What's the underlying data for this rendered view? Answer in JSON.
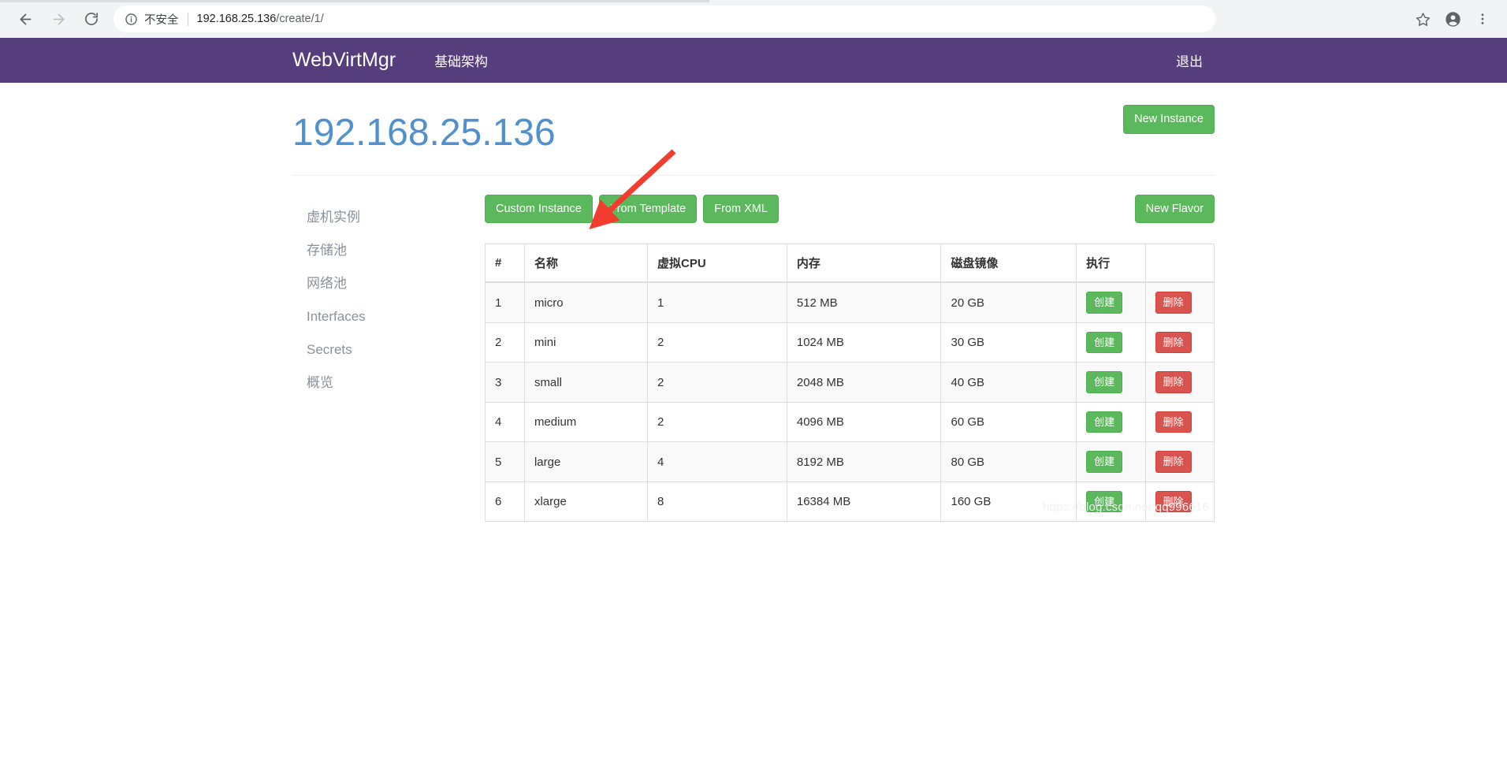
{
  "browser": {
    "back_icon": "arrow-left-icon",
    "forward_icon": "arrow-right-icon",
    "reload_icon": "reload-icon",
    "info_icon": "info-circle-icon",
    "security_label": "不安全",
    "url_host": "192.168.25.136",
    "url_path": "/create/1/",
    "bookmark_icon": "star-icon",
    "profile_icon": "account-avatar-icon",
    "menu_icon": "three-dot-menu-icon"
  },
  "navbar": {
    "brand": "WebVirtMgr",
    "links": [
      {
        "label": "基础架构"
      }
    ],
    "logout_label": "退出",
    "background_color": "#563d7c"
  },
  "page": {
    "title": "192.168.25.136",
    "title_color": "#4f90cd",
    "new_instance_label": "New Instance"
  },
  "sidebar": {
    "items": [
      {
        "label": "虚机实例"
      },
      {
        "label": "存储池"
      },
      {
        "label": "网络池"
      },
      {
        "label": "Interfaces"
      },
      {
        "label": "Secrets"
      },
      {
        "label": "概览"
      }
    ]
  },
  "toolbar": {
    "buttons": [
      {
        "label": "Custom Instance"
      },
      {
        "label": "From Template"
      },
      {
        "label": "From XML"
      }
    ],
    "new_flavor_label": "New Flavor"
  },
  "colors": {
    "success": "#5cb85c",
    "danger": "#d9534f",
    "accent_purple": "#563d7c",
    "heading_blue": "#4f90cd",
    "annotation_red": "#f23c2e"
  },
  "table": {
    "headers": [
      "#",
      "名称",
      "虚拟CPU",
      "内存",
      "磁盘镜像",
      "执行"
    ],
    "action_create_label": "创建",
    "action_delete_label": "删除",
    "rows": [
      {
        "idx": "1",
        "name": "micro",
        "vcpu": "1",
        "memory": "512 MB",
        "disk": "20 GB"
      },
      {
        "idx": "2",
        "name": "mini",
        "vcpu": "2",
        "memory": "1024 MB",
        "disk": "30 GB"
      },
      {
        "idx": "3",
        "name": "small",
        "vcpu": "2",
        "memory": "2048 MB",
        "disk": "40 GB"
      },
      {
        "idx": "4",
        "name": "medium",
        "vcpu": "2",
        "memory": "4096 MB",
        "disk": "60 GB"
      },
      {
        "idx": "5",
        "name": "large",
        "vcpu": "4",
        "memory": "8192 MB",
        "disk": "80 GB"
      },
      {
        "idx": "6",
        "name": "xlarge",
        "vcpu": "8",
        "memory": "16384 MB",
        "disk": "160 GB"
      }
    ]
  },
  "watermark": {
    "text": "https://blog.csdn.net/qq996616"
  }
}
